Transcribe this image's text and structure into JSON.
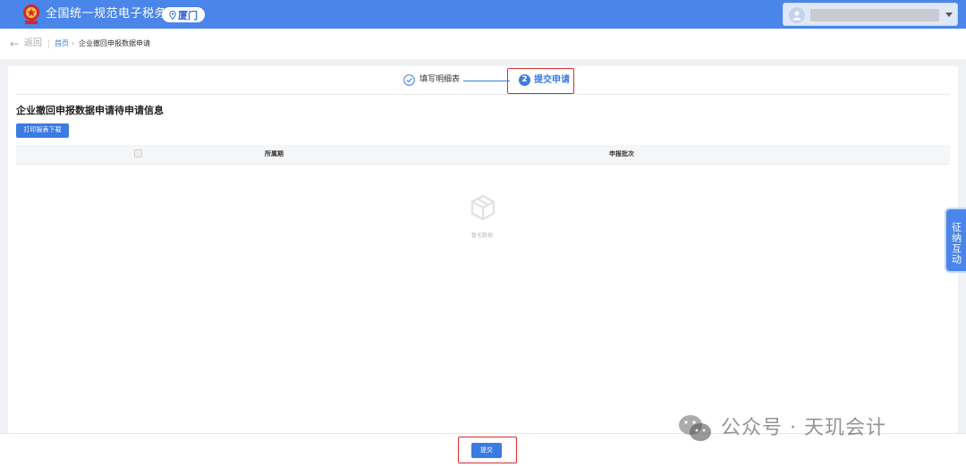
{
  "header": {
    "site_title": "全国统一规范电子税务局",
    "city": "厦门"
  },
  "breadcrumb": {
    "back": "返回",
    "home": "首页",
    "chevron": "›",
    "back_arrow": "←",
    "current": "企业撤回申报数据申请"
  },
  "steps": {
    "step1_label": "填写明细表",
    "step2_number": "2",
    "step2_label": "提交申请"
  },
  "main": {
    "section_title": "企业撤回申报数据申请待申请信息",
    "print_button": "打印报表下载",
    "table": {
      "columns": [
        "所属期",
        "申报批次"
      ]
    },
    "empty_text": "暂无数据"
  },
  "side_float": "征纳互动",
  "footer": {
    "submit_button": "提交"
  },
  "watermark": "公众号 · 天玑会计",
  "colors": {
    "header_bg": "#4a85ea",
    "primary": "#3b7be3",
    "highlight_frame": "#e02b2b"
  }
}
